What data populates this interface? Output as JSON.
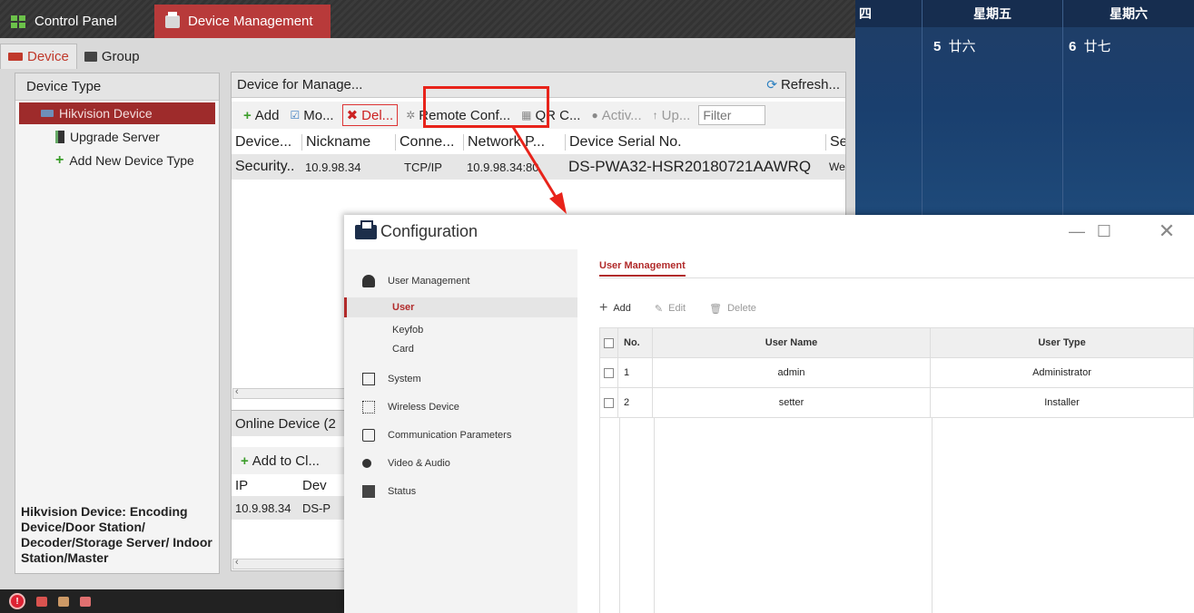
{
  "app": {
    "tabs": [
      {
        "label": "Control Panel"
      },
      {
        "label": "Device Management"
      }
    ],
    "subtabs": [
      {
        "label": "Device"
      },
      {
        "label": "Group"
      }
    ],
    "device_type": {
      "header": "Device Type",
      "items": [
        {
          "label": "Hikvision Device"
        },
        {
          "label": "Upgrade Server"
        },
        {
          "label": "Add New Device Type"
        }
      ],
      "description": "Hikvision Device: Encoding Device/Door Station/ Decoder/Storage Server/ Indoor Station/Master"
    },
    "device_for_manage": {
      "header": "Device for Manage...",
      "refresh_label": "Refresh...",
      "toolbar": {
        "add": "Add",
        "modify": "Mo...",
        "delete": "Del...",
        "remote_config": "Remote Conf...",
        "qr_code": "QR C...",
        "activate": "Activ...",
        "upgrade": "Up...",
        "filter_placeholder": "Filter"
      },
      "columns": [
        "Device...",
        "Nickname",
        "Conne...",
        "Network P...",
        "Device Serial No.",
        "Secu"
      ],
      "rows": [
        {
          "device": "Security..",
          "nickname": "10.9.98.34",
          "connection": "TCP/IP",
          "network": "10.9.98.34:80",
          "serial": "DS-PWA32-HSR20180721AAWRQ",
          "security": "Wea"
        }
      ]
    },
    "online_device": {
      "header": "Online Device (2",
      "add_to_client": "Add to Cl...",
      "columns": [
        "IP",
        "Dev"
      ],
      "rows": [
        {
          "ip": "10.9.98.34",
          "dev": "DS-P"
        }
      ]
    }
  },
  "calendar": {
    "headers": [
      "四",
      "星期五",
      "星期六"
    ],
    "cells": [
      {
        "day": "",
        "lunar": ""
      },
      {
        "day": "5",
        "lunar": "廿六"
      },
      {
        "day": "6",
        "lunar": "廿七"
      }
    ]
  },
  "config": {
    "title": "Configuration",
    "sidebar": {
      "user_management": "User Management",
      "user": "User",
      "keyfob": "Keyfob",
      "card": "Card",
      "system": "System",
      "wireless_device": "Wireless Device",
      "communication_parameters": "Communication Parameters",
      "video_audio": "Video & Audio",
      "status": "Status"
    },
    "main": {
      "tab": "User Management",
      "toolbar": {
        "add": "Add",
        "edit": "Edit",
        "delete": "Delete"
      },
      "columns": {
        "no": "No.",
        "user_name": "User Name",
        "user_type": "User Type"
      },
      "rows": [
        {
          "no": "1",
          "user_name": "admin",
          "user_type": "Administrator"
        },
        {
          "no": "2",
          "user_name": "setter",
          "user_type": "Installer"
        }
      ]
    }
  },
  "colors": {
    "accent_red": "#b83a3a",
    "highlight_red": "#e8231a",
    "selected_item": "#9e2b2b"
  }
}
